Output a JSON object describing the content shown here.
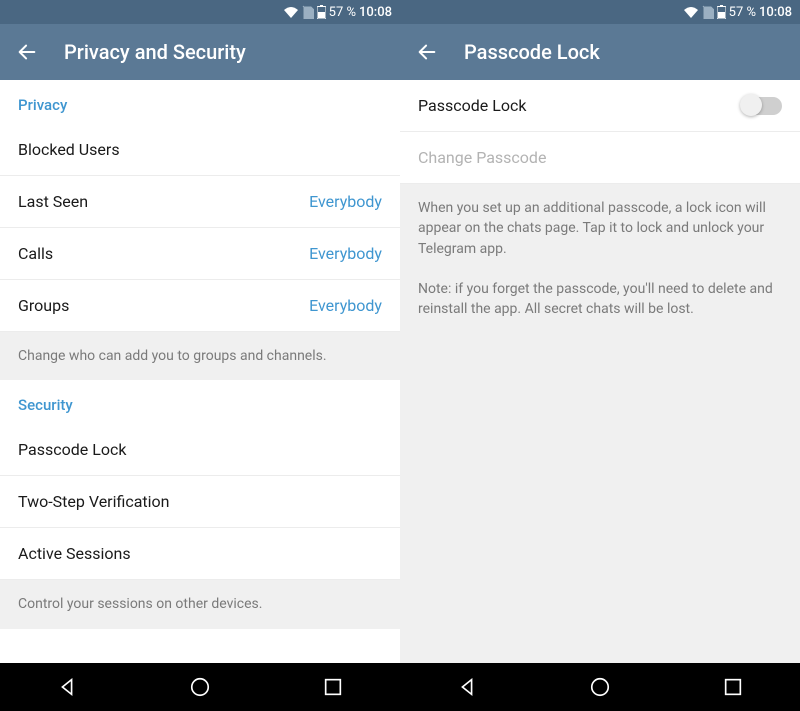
{
  "status": {
    "battery": "57 %",
    "time": "10:08"
  },
  "left": {
    "title": "Privacy and Security",
    "sections": {
      "privacy": {
        "header": "Privacy",
        "blocked": "Blocked Users",
        "lastseen": {
          "label": "Last Seen",
          "value": "Everybody"
        },
        "calls": {
          "label": "Calls",
          "value": "Everybody"
        },
        "groups": {
          "label": "Groups",
          "value": "Everybody"
        },
        "hint": "Change who can add you to groups and channels."
      },
      "security": {
        "header": "Security",
        "passcode": "Passcode Lock",
        "twostep": "Two-Step Verification",
        "sessions": "Active Sessions",
        "hint": "Control your sessions on other devices."
      }
    }
  },
  "right": {
    "title": "Passcode Lock",
    "rows": {
      "passcode": "Passcode Lock",
      "change": "Change Passcode"
    },
    "hint1": "When you set up an additional passcode, a lock icon will appear on the chats page. Tap it to lock and unlock your Telegram app.",
    "hint2": "Note: if you forget the passcode, you'll need to delete and reinstall the app. All secret chats will be lost."
  }
}
